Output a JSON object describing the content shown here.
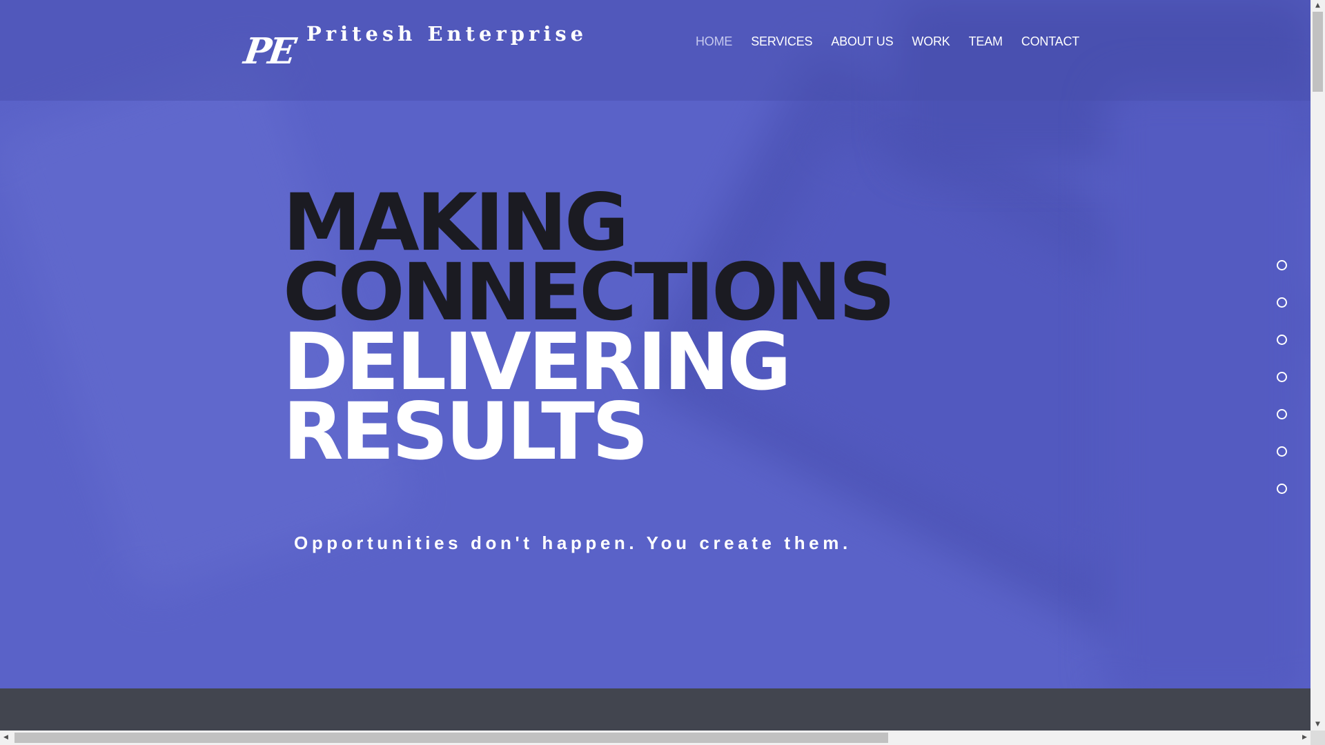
{
  "brand": {
    "logo_mark": "PE",
    "name": "Pritesh Enterprise"
  },
  "nav": {
    "items": [
      {
        "label": "HOME",
        "active": true
      },
      {
        "label": "SERVICES",
        "active": false
      },
      {
        "label": "ABOUT US",
        "active": false
      },
      {
        "label": "WORK",
        "active": false
      },
      {
        "label": "TEAM",
        "active": false
      },
      {
        "label": "CONTACT",
        "active": false
      }
    ]
  },
  "hero": {
    "lines": [
      "MAKING",
      "CONNECTIONS",
      "DELIVERING",
      "RESULTS"
    ],
    "tagline": "Opportunities don't happen. You create them."
  },
  "section_dots": {
    "count": 7
  },
  "colors": {
    "hero_background": "#5a62c8",
    "dark_text": "#1b1b22",
    "light_text": "#ffffff",
    "nav_active": "#c6c9ef",
    "footer_band": "#42454f"
  },
  "icons": {
    "scroll_up": "▲",
    "scroll_down": "▼",
    "scroll_left": "◀",
    "scroll_right": "▶"
  }
}
